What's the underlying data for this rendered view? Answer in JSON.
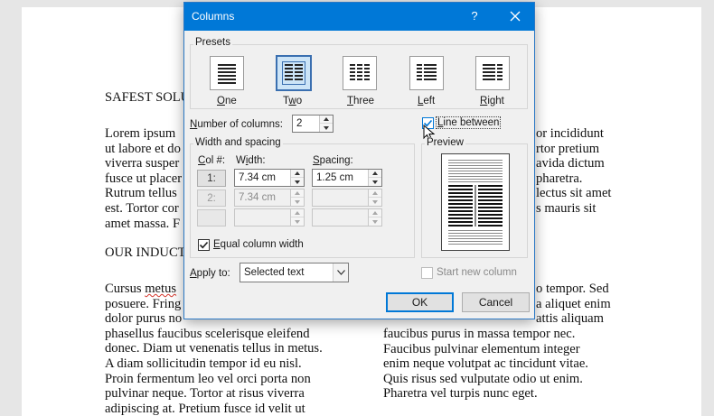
{
  "document": {
    "left_column": {
      "heading1": "SAFEST SOLU",
      "para1": [
        "Lorem ipsum",
        "ut labore et do",
        "viverra susper",
        "fusce ut placer",
        "Rutrum tellus",
        "est. Tortor cor",
        "amet massa. F"
      ],
      "heading2": "OUR INDUCT",
      "para2_line1_word": "Cursus ",
      "para2_line1_misspelled": "metus",
      "para2": [
        "posuere. Fring",
        "dolor purus no",
        "phasellus faucibus scelerisque eleifend",
        "donec. Diam ut venenatis tellus in metus.",
        "A diam sollicitudin tempor id eu nisl.",
        "Proin fermentum leo vel orci porta non",
        "pulvinar neque. Tortor at risus viverra",
        "adipiscing at. Pretium fusce id velit ut"
      ]
    },
    "right_column": {
      "para1": [
        "or incididunt",
        "rtor pretium",
        "avida dictum",
        "pharetra.",
        "lectus sit amet",
        "s mauris sit"
      ],
      "para2": [
        "o tempor. Sed",
        "a aliquet enim",
        "attis aliquam",
        "faucibus purus in massa tempor nec.",
        "Faucibus pulvinar elementum integer",
        "enim neque volutpat ac tincidunt vitae.",
        "Quis risus sed vulputate odio ut enim.",
        "Pharetra vel turpis nunc eget."
      ]
    }
  },
  "dialog": {
    "title": "Columns",
    "help": "?",
    "presets_label": "Presets",
    "presets": [
      {
        "label": "One",
        "accel": "O",
        "rest": "ne"
      },
      {
        "label": "Two",
        "accel": "w",
        "pre": "T",
        "rest": "o"
      },
      {
        "label": "Three",
        "accel": "T",
        "rest": "hree"
      },
      {
        "label": "Left",
        "accel": "L",
        "rest": "eft"
      },
      {
        "label": "Right",
        "accel": "R",
        "rest": "ight"
      }
    ],
    "selected_preset": "Two",
    "number_of_columns_label": {
      "accel": "N",
      "rest": "umber of columns:"
    },
    "number_of_columns_value": "2",
    "line_between": {
      "accel": "L",
      "rest": "ine between",
      "checked": true
    },
    "width_spacing_label": "Width and spacing",
    "col_header": {
      "accel": "C",
      "rest": "ol #:"
    },
    "width_header": {
      "pre": "W",
      "accel": "i",
      "rest": "dth:"
    },
    "spacing_header": {
      "accel": "S",
      "rest": "pacing:"
    },
    "rows": [
      {
        "col": "1:",
        "width": "7.34 cm",
        "spacing": "1.25 cm"
      },
      {
        "col": "2:",
        "width": "7.34 cm",
        "spacing": ""
      },
      {
        "col": "",
        "width": "",
        "spacing": ""
      }
    ],
    "equal_width": {
      "accel": "E",
      "rest": "qual column width",
      "checked": true
    },
    "preview_label": "Preview",
    "apply_to_label": {
      "accel": "A",
      "rest": "pply to:"
    },
    "apply_to_value": "Selected text",
    "start_new_column": "Start new column",
    "ok": "OK",
    "cancel": "Cancel"
  },
  "colors": {
    "title_bar": "#0078d7",
    "selected_preset": "#cce4f7",
    "focus": "#0078d7"
  }
}
